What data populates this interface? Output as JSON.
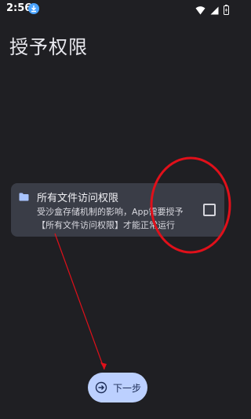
{
  "status_bar": {
    "time": "2:56",
    "icons": [
      "download-icon",
      "wifi-icon",
      "signal-icon",
      "battery-icon"
    ]
  },
  "page": {
    "title": "授予权限"
  },
  "permission_card": {
    "icon": "folder-icon",
    "title": "所有文件访问权限",
    "description": "受沙盒存储机制的影响，App需要授予【所有文件访问权限】才能正常运行",
    "checked": false
  },
  "next_button": {
    "label": "下一步",
    "icon": "arrow-right-circle-icon"
  },
  "colors": {
    "background": "#1f1f23",
    "card": "#3a3d47",
    "button": "#bcd0ff",
    "annotation": "#e0101a"
  }
}
